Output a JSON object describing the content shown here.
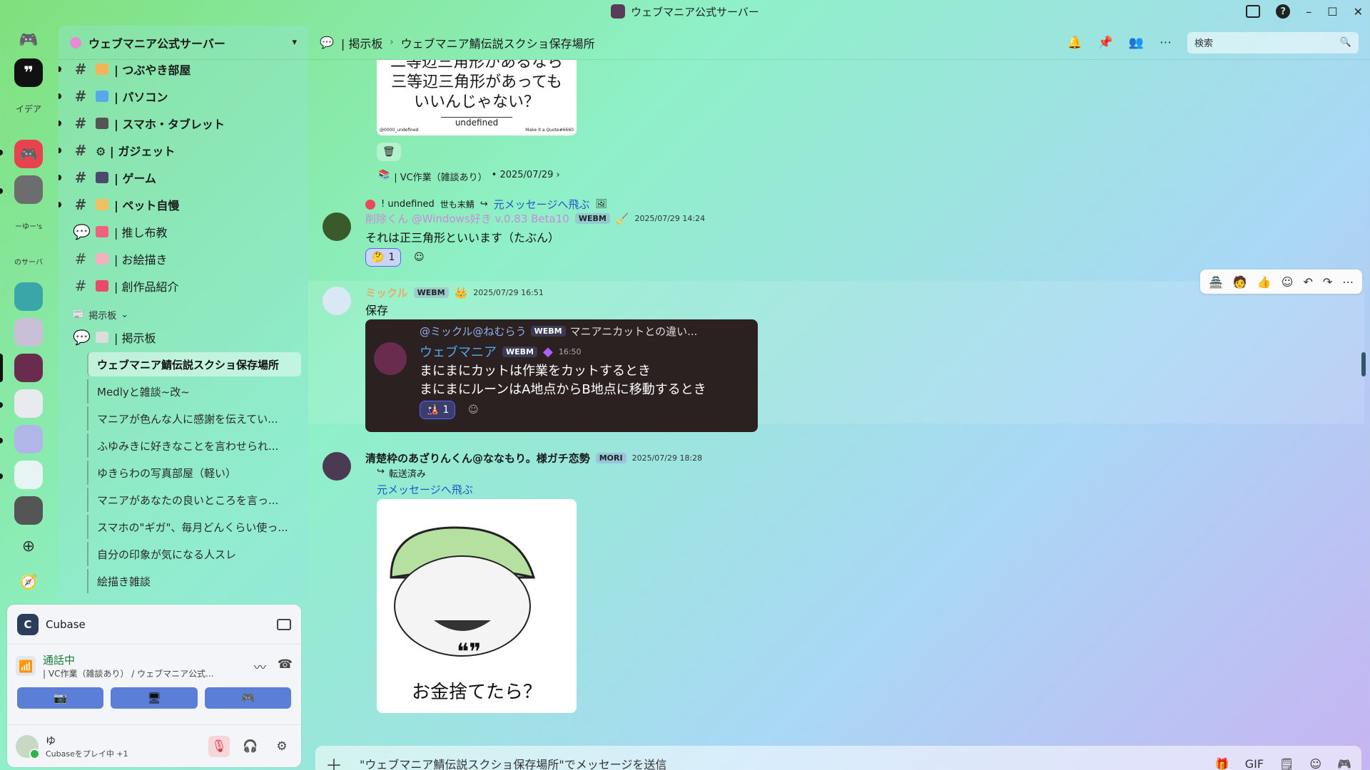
{
  "window": {
    "title": "ウェブマニア公式サーバー"
  },
  "rail": {
    "labels": [
      "イデア",
      "ーゆー's",
      "のサーバ"
    ]
  },
  "sidebar": {
    "server_name": "ウェブマニア公式サーバー",
    "channels": [
      {
        "label": "| つぶやき部屋",
        "bold": true
      },
      {
        "label": "| パソコン",
        "bold": true
      },
      {
        "label": "| スマホ・タブレット",
        "bold": true
      },
      {
        "label": "⚙ | ガジェット",
        "bold": true
      },
      {
        "label": "| ゲーム",
        "bold": true
      },
      {
        "label": "| ペット自慢",
        "bold": true
      },
      {
        "label": "| 推し布教",
        "bold": false
      },
      {
        "label": "| お絵描き",
        "bold": false
      },
      {
        "label": "| 創作品紹介",
        "bold": false
      }
    ],
    "category": "掲示板",
    "forum": "| 掲示板",
    "threads": [
      "ウェブマニア鯖伝説スクショ保存場所",
      "Medlyと雑談~改~",
      "マニアが色んな人に感謝を伝えてい...",
      "ふゆみきに好きなことを言わせられ...",
      "ゆきらわの写真部屋（軽い）",
      "マニアがあなたの良いところを言っ...",
      "スマホの\"ギガ\"、毎月どんくらい使っ...",
      "自分の印象が気になる人スレ",
      "絵描き雑談"
    ]
  },
  "panel": {
    "activity": "Cubase",
    "voice_status": "通話中",
    "voice_channel": "| VC作業（雑談あり） / ウェブマニア公式...",
    "user_name": "ゆ",
    "user_status": "Cubaseをプレイ中 +1"
  },
  "topbar": {
    "forum": "| 掲示板",
    "thread": "ウェブマニア鯖伝説スクショ保存場所",
    "search_placeholder": "検索"
  },
  "messages": {
    "m0": {
      "quote_text_1": "二等辺三角形があるなら",
      "quote_text_2": "三等辺三角形があっても",
      "quote_text_3": "いいんじゃない？",
      "quote_author": "undefined",
      "quote_handle": "@0000_undefined",
      "quote_footer": "Make it a Quote#6660",
      "source": "| VC作業（雑談あり）",
      "source_date": "• 2025/07/29 ›"
    },
    "m1": {
      "reply_user": "! undefined",
      "reply_badge": "世も末鯖",
      "reply_jump": "元メッセージへ飛ぶ",
      "author": "削除くん @Windows好き v.0.83 Beta10",
      "tag": "WEBM",
      "time": "2025/07/29 14:24",
      "text": "それは正三角形といいます（たぶん）",
      "reaction_count": "1"
    },
    "m2": {
      "author": "ミックル",
      "tag": "WEBM",
      "time": "2025/07/29 16:51",
      "text": "保存",
      "embed_reply": "@ミックル@ねむらう",
      "embed_reply_tag": "WEBM",
      "embed_reply_text": "マニアニカットとの違い...",
      "embed_author": "ウェブマニア",
      "embed_tag": "WEBM",
      "embed_time": "16:50",
      "embed_line1": "まにまにカットは作業をカットするとき",
      "embed_line2": "まにまにルーンはA地点からB地点に移動するとき",
      "embed_reaction": "1"
    },
    "m3": {
      "author": "清楚枠のあざりんくん@ななもり。様ガチ恋勢",
      "tag": "MORI",
      "time": "2025/07/29 18:28",
      "forwarded": "転送済み",
      "jump": "元メッセージへ飛ぶ",
      "image_caption": "お金捨てたら？"
    }
  },
  "composer": {
    "placeholder": "\"ウェブマニア鯖伝説スクショ保存場所\"でメッセージを送信"
  },
  "colors": {
    "accent": "#5865f2",
    "link": "#2257c8"
  }
}
